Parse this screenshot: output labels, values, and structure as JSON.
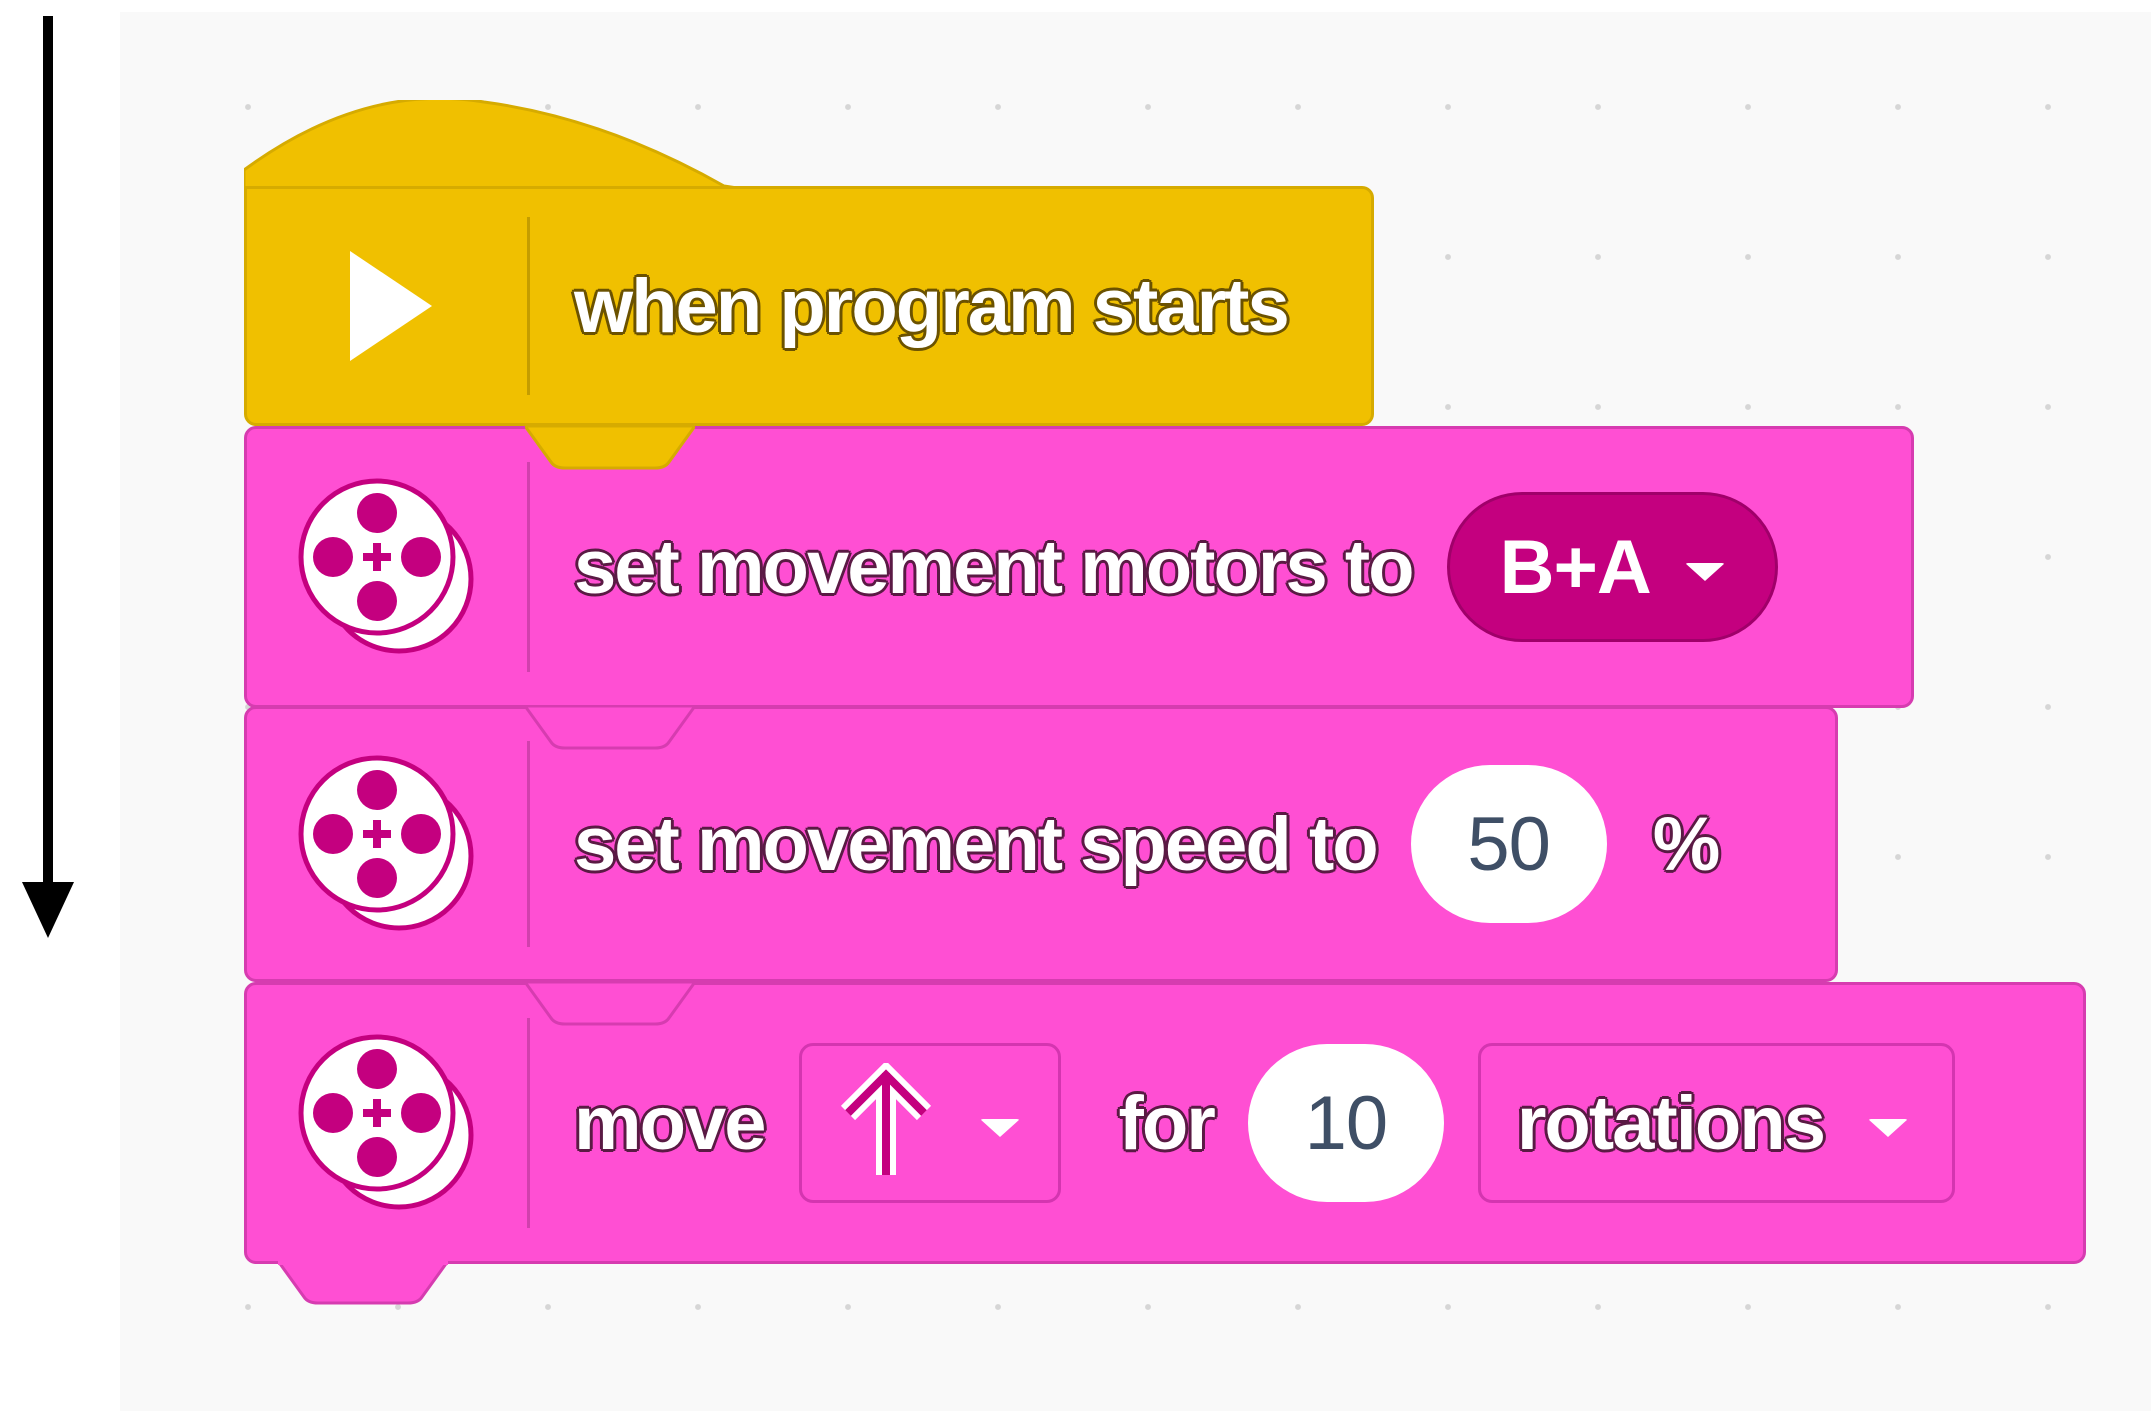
{
  "hat_block": {
    "label": "when program starts",
    "icon": "play-icon",
    "color": "#f0c000"
  },
  "blocks": [
    {
      "id": "set-motors",
      "label": "set movement motors to",
      "dropdown_value": "B+A",
      "icon": "motor-pair-icon",
      "color": "#ff4fd3"
    },
    {
      "id": "set-speed",
      "label": "set movement speed to",
      "value": "50",
      "unit": "%",
      "icon": "motor-pair-icon",
      "color": "#ff4fd3"
    },
    {
      "id": "move",
      "label": "move",
      "direction": "up-arrow-icon",
      "for_label": "for",
      "value": "10",
      "unit_dropdown": "rotations",
      "icon": "motor-pair-icon",
      "color": "#ff4fd3"
    }
  ],
  "flow_arrow": "down-arrow-icon"
}
